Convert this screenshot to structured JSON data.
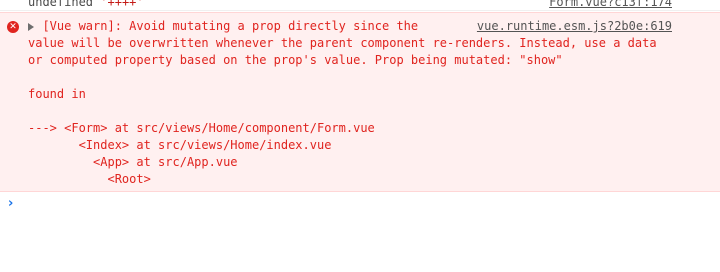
{
  "previous_log": {
    "text": "undefined",
    "string_value": "'++++'",
    "source_link": "Form.vue?c13f:174"
  },
  "error": {
    "icon": "error-icon",
    "source_link": "vue.runtime.esm.js?2b0e:619",
    "first_line": "[Vue warn]: Avoid mutating a prop directly since the",
    "lines": [
      "value will be overwritten whenever the parent component re-renders. Instead, use a data",
      "or computed property based on the prop's value. Prop being mutated: \"show\"",
      "",
      "found in",
      "",
      "---> <Form> at src/views/Home/component/Form.vue",
      "       <Index> at src/views/Home/index.vue",
      "         <App> at src/App.vue",
      "           <Root>"
    ]
  },
  "prompt": {
    "caret": "›",
    "value": ""
  },
  "colors": {
    "error_text": "#e0241f",
    "error_background": "#fff0f0",
    "prompt_caret": "#1a73e8"
  }
}
